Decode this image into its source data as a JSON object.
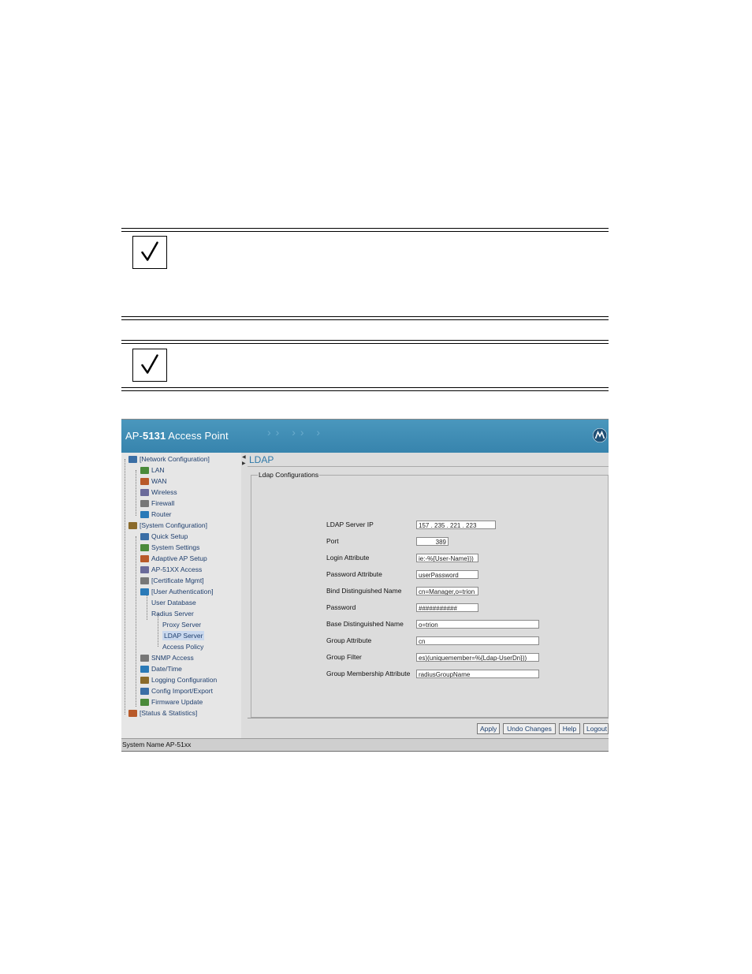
{
  "app": {
    "title_prefix": "AP-",
    "title_model": "5131",
    "title_suffix": " Access Point"
  },
  "tree": [
    {
      "label": "[Network Configuration]",
      "icon": "network-config-icon",
      "level": 0
    },
    {
      "label": "LAN",
      "icon": "lan-icon",
      "level": 1
    },
    {
      "label": "WAN",
      "icon": "wan-icon",
      "level": 1
    },
    {
      "label": "Wireless",
      "icon": "wireless-icon",
      "level": 1
    },
    {
      "label": "Firewall",
      "icon": "firewall-icon",
      "level": 1
    },
    {
      "label": "Router",
      "icon": "router-icon",
      "level": 1
    },
    {
      "label": "[System Configuration]",
      "icon": "system-config-icon",
      "level": 0
    },
    {
      "label": "Quick Setup",
      "icon": "quick-setup-icon",
      "level": 1
    },
    {
      "label": "System Settings",
      "icon": "system-settings-icon",
      "level": 1
    },
    {
      "label": "Adaptive AP Setup",
      "icon": "adaptive-ap-icon",
      "level": 1
    },
    {
      "label": "AP-51XX Access",
      "icon": "ap-access-icon",
      "level": 1
    },
    {
      "label": "[Certificate Mgmt]",
      "icon": "certificate-icon",
      "level": 1
    },
    {
      "label": "[User Authentication]",
      "icon": "user-auth-icon",
      "level": 1
    },
    {
      "label": "User Database",
      "icon": "",
      "level": 2
    },
    {
      "label": "Radius Server",
      "icon": "",
      "level": 2
    },
    {
      "label": "Proxy Server",
      "icon": "",
      "level": 3
    },
    {
      "label": "LDAP Server",
      "icon": "",
      "level": 3
    },
    {
      "label": "Access Policy",
      "icon": "",
      "level": 3
    },
    {
      "label": "SNMP Access",
      "icon": "snmp-icon",
      "level": 1
    },
    {
      "label": "Date/Time",
      "icon": "clock-icon",
      "level": 1
    },
    {
      "label": "Logging Configuration",
      "icon": "logging-icon",
      "level": 1
    },
    {
      "label": "Config Import/Export",
      "icon": "config-import-icon",
      "level": 1
    },
    {
      "label": "Firmware Update",
      "icon": "firmware-icon",
      "level": 1
    },
    {
      "label": "[Status & Statistics]",
      "icon": "status-icon",
      "level": 0
    }
  ],
  "main": {
    "page_title": "LDAP",
    "group_title": "Ldap Configurations",
    "fields": [
      {
        "label": "LDAP Server IP",
        "value": "157 . 235 . 221 . 223"
      },
      {
        "label": "Port",
        "value": "389"
      },
      {
        "label": "Login Attribute",
        "value": "ie:-%{User-Name}))"
      },
      {
        "label": "Password Attribute",
        "value": "userPassword"
      },
      {
        "label": "Bind Distinguished Name",
        "value": "cn=Manager,o=trion"
      },
      {
        "label": "Password",
        "value": "###########"
      },
      {
        "label": "Base Distinguished Name",
        "value": "o=trion"
      },
      {
        "label": "Group Attribute",
        "value": "cn"
      },
      {
        "label": "Group Filter",
        "value": "es)(uniquemember=%{Ldap-UserDn}))"
      },
      {
        "label": "Group Membership Attribute",
        "value": "radiusGroupName"
      }
    ],
    "buttons": {
      "apply": "Apply",
      "undo": "Undo Changes",
      "help": "Help",
      "logout": "Logout"
    }
  },
  "status_bar": "System Name AP-51xx",
  "colors": {
    "header": "#3a88b1",
    "title": "#2f79a8",
    "panel": "#dcdcdc"
  }
}
